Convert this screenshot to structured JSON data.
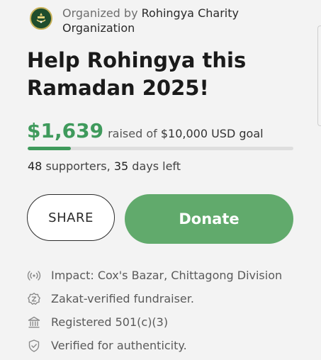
{
  "organizer": {
    "prefix": "Organized by",
    "name": "Rohingya Charity Organization",
    "logo_icon": "charity-crest-icon"
  },
  "campaign": {
    "title": "Help Rohingya this Ramadan 2025!"
  },
  "funding": {
    "raised": "$1,639",
    "raised_of": "raised of",
    "goal": "$10,000",
    "goal_suffix": "USD goal",
    "progress_fraction": 0.1639,
    "accent_color": "#3f9a5c"
  },
  "stats": {
    "supporters_count": "48",
    "supporters_label": "supporters,",
    "days_count": "35",
    "days_label": "days left"
  },
  "actions": {
    "share_label": "SHARE",
    "donate_label": "Donate",
    "donate_color": "#61aa6c"
  },
  "features": [
    {
      "icon": "broadcast-icon",
      "label": "Impact: Cox's Bazar, Chittagong Division"
    },
    {
      "icon": "zakat-icon",
      "label": "Zakat-verified fundraiser."
    },
    {
      "icon": "bank-icon",
      "label": "Registered 501(c)(3)"
    },
    {
      "icon": "shield-check-icon",
      "label": "Verified for authenticity."
    }
  ]
}
